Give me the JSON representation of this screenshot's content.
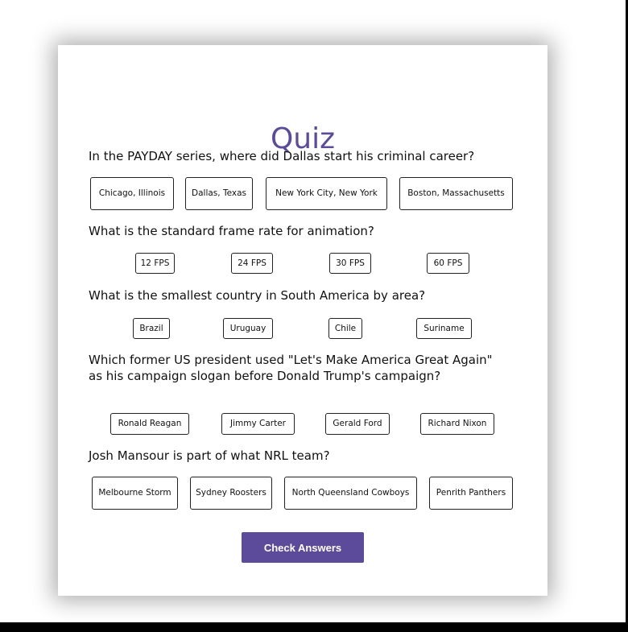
{
  "quiz": {
    "title": "Quiz",
    "questions": [
      {
        "text": "In the PAYDAY series, where did Dallas start his criminal career?",
        "options": [
          "Chicago, Illinois",
          "Dallas, Texas",
          "New York City, New York",
          "Boston, Massachusetts"
        ]
      },
      {
        "text": "What is the standard frame rate for animation?",
        "options": [
          "12 FPS",
          "24 FPS",
          "30 FPS",
          "60 FPS"
        ]
      },
      {
        "text": "What is the smallest country in South America by area?",
        "options": [
          "Brazil",
          "Uruguay",
          "Chile",
          "Suriname"
        ]
      },
      {
        "text": "Which former US president used \"Let's Make America Great Again\" as his campaign slogan before Donald Trump's campaign?",
        "options": [
          "Ronald Reagan",
          "Jimmy Carter",
          "Gerald Ford",
          "Richard Nixon"
        ]
      },
      {
        "text": "Josh Mansour is part of what NRL team?",
        "options": [
          "Melbourne Storm",
          "Sydney Roosters",
          "North Queensland Cowboys",
          "Penrith Panthers"
        ]
      }
    ],
    "submit_label": "Check Answers",
    "accent_color": "#5b4b9a"
  }
}
